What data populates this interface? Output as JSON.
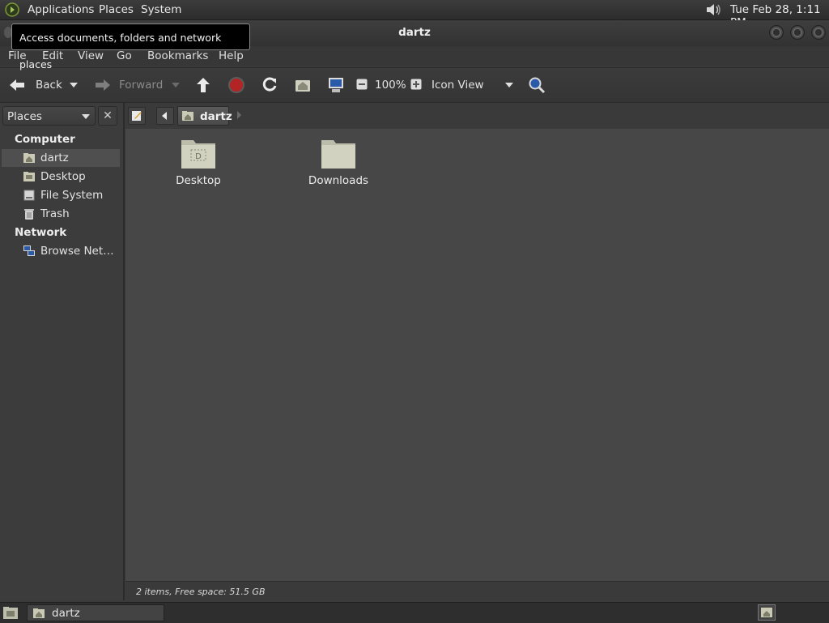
{
  "top_panel": {
    "menus": [
      "Applications",
      "Places",
      "System"
    ],
    "clock": "Tue Feb 28,  1:11 PM",
    "volume_icon": "speaker-icon"
  },
  "window": {
    "title": "dartz"
  },
  "tooltip": "Access documents, folders and network places",
  "menubar": [
    "File",
    "Edit",
    "View",
    "Go",
    "Bookmarks",
    "Help"
  ],
  "toolbar": {
    "back_label": "Back",
    "forward_label": "Forward",
    "zoom_level": "100%",
    "view_mode": "Icon View"
  },
  "sidebar": {
    "combo_label": "Places",
    "sections": [
      {
        "heading": "Computer",
        "items": [
          {
            "label": "dartz",
            "icon": "home-folder-icon",
            "selected": true
          },
          {
            "label": "Desktop",
            "icon": "desktop-folder-icon"
          },
          {
            "label": "File System",
            "icon": "drive-icon"
          },
          {
            "label": "Trash",
            "icon": "trash-icon"
          }
        ]
      },
      {
        "heading": "Network",
        "items": [
          {
            "label": "Browse Net…",
            "icon": "network-icon"
          }
        ]
      }
    ]
  },
  "pathbar": {
    "current": "dartz"
  },
  "files": [
    {
      "name": "Desktop",
      "icon": "desktop-folder-icon"
    },
    {
      "name": "Downloads",
      "icon": "folder-icon"
    }
  ],
  "status": "2 items, Free space: 51.5 GB",
  "taskbar": {
    "task_label": "dartz"
  },
  "colors": {
    "background": "#3a3a3a",
    "content": "#474747",
    "folder": "#c9c9b4"
  }
}
